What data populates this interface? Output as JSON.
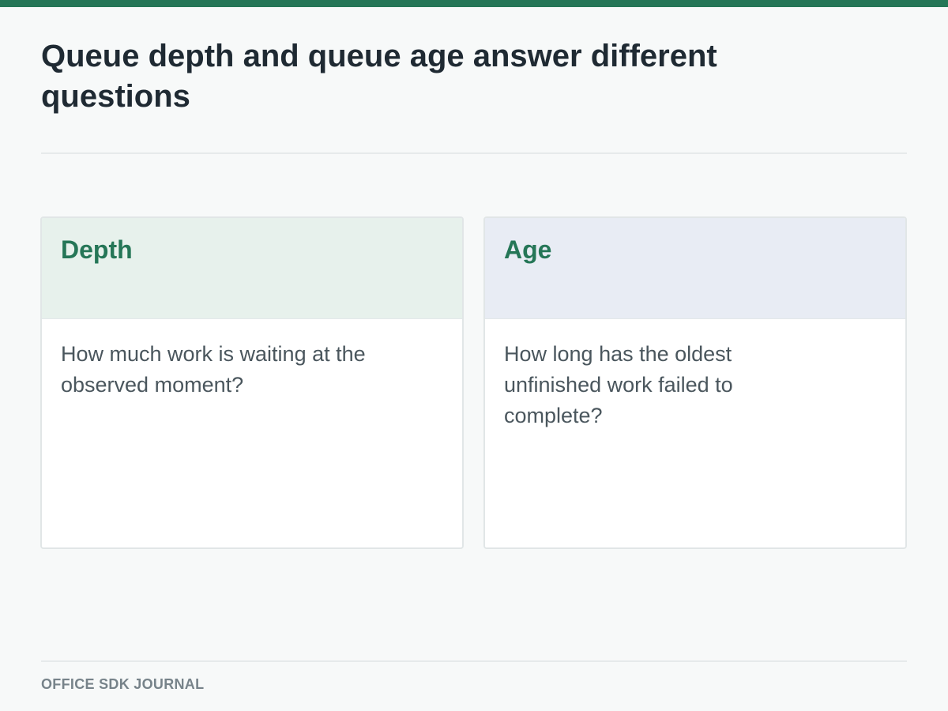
{
  "page": {
    "title": "Queue depth and queue age answer different questions",
    "accent_color": "#257657"
  },
  "cards": [
    {
      "heading": "Depth",
      "text": "How much work is waiting at the observed moment?",
      "header_color": "#e7f1ec"
    },
    {
      "heading": "Age",
      "text": "How long has the oldest unfinished work failed to complete?",
      "header_color": "#e8ecf4"
    }
  ],
  "footer": {
    "label": "OFFICE SDK JOURNAL"
  }
}
